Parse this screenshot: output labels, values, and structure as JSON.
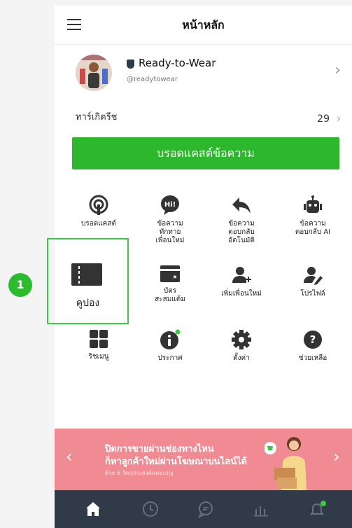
{
  "header": {
    "title": "หน้าหลัก"
  },
  "profile": {
    "name": "Ready-to-Wear",
    "handle": "@readytowear"
  },
  "birthday": {
    "label": "ทาร์เกิตรีช",
    "count": "29"
  },
  "broadcast_button": "บรอดแคสต์ข้อความ",
  "menu": {
    "broadcast": "บรอดแคสต์",
    "greeting": "ข้อความ\nทักทาย\nเพื่อนใหม่",
    "auto_reply": "ข้อความ\nตอบกลับ\nอัตโนมัติ",
    "ai_reply": "ข้อความ\nตอบกลับ AI",
    "coupon": "คูปอง",
    "reward_card": "บัตร\nสะสมแต้ม",
    "add_friends": "เพิ่มเพื่อนใหม่",
    "profile": "โปรไฟล์",
    "rich_menu": "ริชเมนู",
    "announcement": "ประกาศ",
    "settings": "ตั้งค่า",
    "help": "ช่วยเหลือ"
  },
  "annotation": {
    "step": "1"
  },
  "banner": {
    "line1": "ปิดการขายผ่านช่องทางไหน",
    "line2": "ก็หาลูกค้าใหม่ผ่านโฆษณาบนไลน์ได้",
    "line3": "ด้วย 6 วัตถุประสงค์แคมเปญ"
  },
  "colors": {
    "accent": "#2cb72c",
    "banner": "#f08a93",
    "nav": "#303a48"
  }
}
